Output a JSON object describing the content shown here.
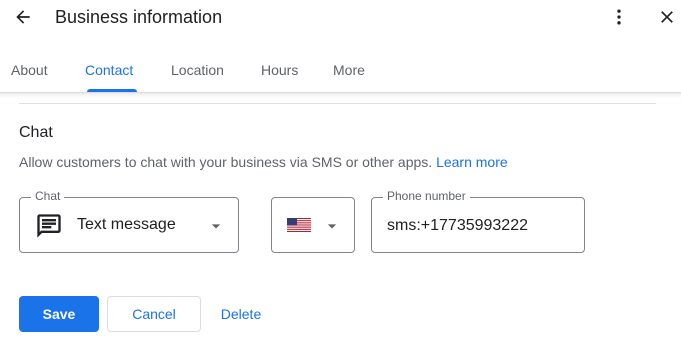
{
  "header": {
    "title": "Business information",
    "back_icon": "arrow-back-icon",
    "menu_icon": "more-vert-icon",
    "close_icon": "close-icon"
  },
  "tabs": [
    {
      "label": "About",
      "active": false
    },
    {
      "label": "Contact",
      "active": true
    },
    {
      "label": "Location",
      "active": false
    },
    {
      "label": "Hours",
      "active": false
    },
    {
      "label": "More",
      "active": false
    }
  ],
  "chat_section": {
    "title": "Chat",
    "description": "Allow customers to chat with your business via SMS or other apps.",
    "learn_more": "Learn more",
    "chat_select": {
      "label": "Chat",
      "value": "Text message",
      "icon": "chat-message-icon"
    },
    "country_select": {
      "icon": "us-flag-icon"
    },
    "phone_field": {
      "label": "Phone number",
      "value": "sms:+17735993222"
    }
  },
  "actions": {
    "save": "Save",
    "cancel": "Cancel",
    "delete": "Delete"
  },
  "colors": {
    "accent": "#1a73e8",
    "text_primary": "#202124",
    "text_secondary": "#5f6368",
    "border": "#80868b"
  }
}
